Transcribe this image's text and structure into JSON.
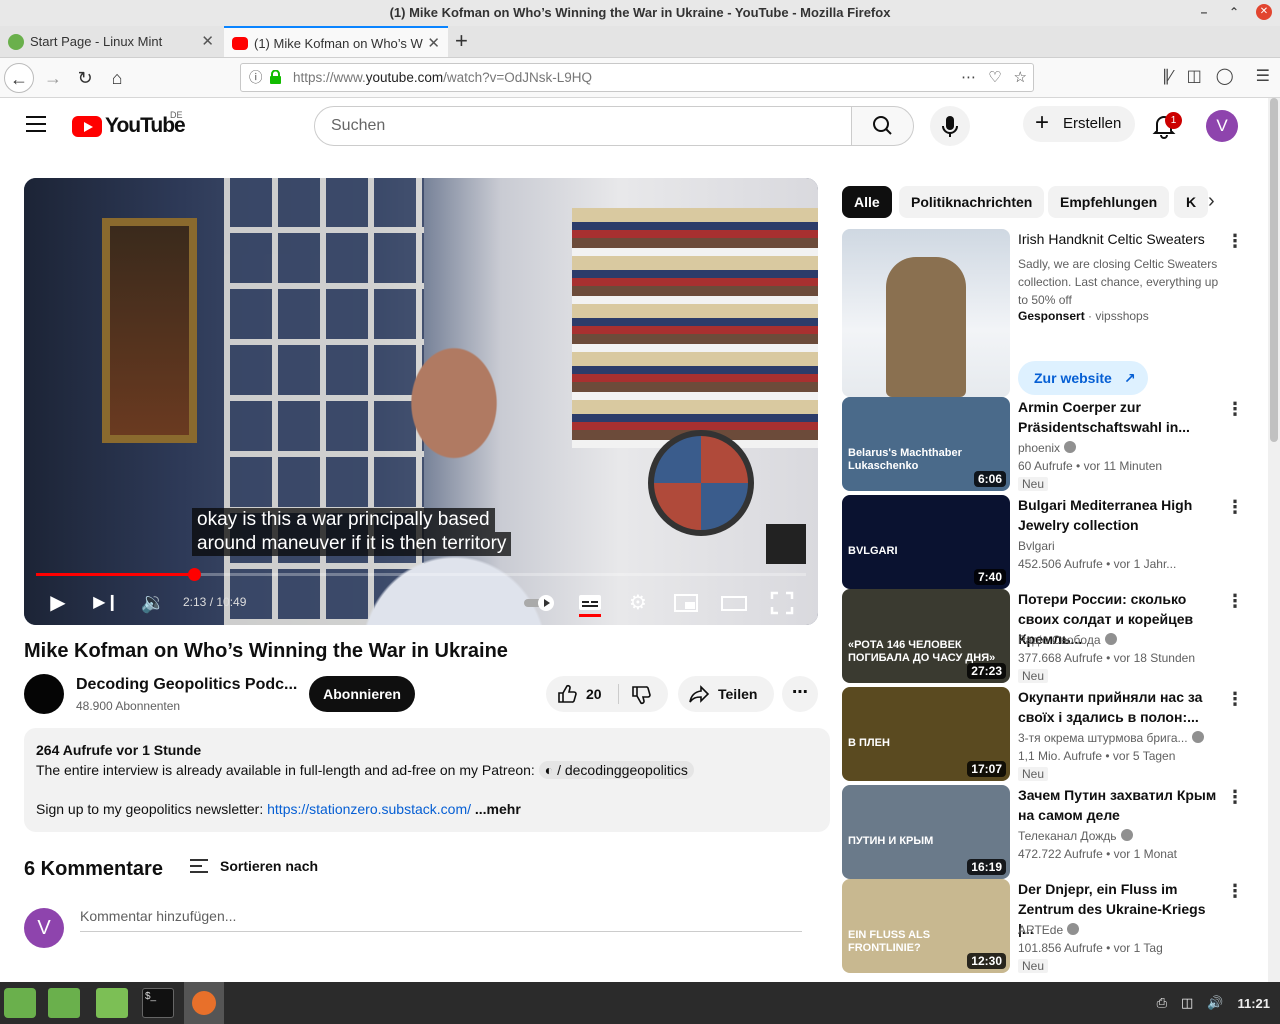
{
  "window": {
    "title": "(1) Mike Kofman on Who’s Winning the War in Ukraine - YouTube - Mozilla Firefox"
  },
  "tabs": [
    {
      "label": "Start Page - Linux Mint",
      "favicon_color": "#6ab04c"
    },
    {
      "label": "(1) Mike Kofman on Who’s W",
      "favicon_color": "#ff0000"
    }
  ],
  "address": {
    "prefix": "https://www.",
    "domain": "youtube.com",
    "path": "/watch?v=OdJNsk-L9HQ"
  },
  "yt": {
    "logo_text": "YouTube",
    "country": "DE",
    "search_placeholder": "Suchen",
    "create_label": "Erstellen",
    "notifications": "1",
    "avatar_letter": "V"
  },
  "player": {
    "caption_line1": "okay is this a war principally based",
    "caption_line2": "around maneuver if it is then territory",
    "time": "2:13 / 10:49",
    "progress": 0.205
  },
  "video": {
    "title": "Mike Kofman on Who’s Winning the War in Ukraine",
    "channel": "Decoding Geopolitics Podc...",
    "subscribers": "48.900 Abonnenten",
    "subscribe_label": "Abonnieren",
    "likes": "20",
    "share_label": "Teilen",
    "views_time": "264 Aufrufe  vor 1 Stunde",
    "desc_line1": "The entire interview is already available in full-length and ad-free on my Patreon:",
    "desc_chip": "/ decodinggeopolitics",
    "desc_line2": "Sign up to my geopolitics newsletter:",
    "desc_link": "https://stationzero.substack.com/",
    "more": "...mehr"
  },
  "comments": {
    "heading": "6 Kommentare",
    "sort_label": "Sortieren nach",
    "placeholder": "Kommentar hinzufügen..."
  },
  "chips": [
    "Alle",
    "Politiknachrichten",
    "Empfehlungen",
    "K"
  ],
  "ad": {
    "title": "Irish Handknit Celtic Sweaters",
    "desc": "Sadly, we are closing Celtic Sweaters collection. Last chance, everything up to 50% off",
    "sponsored": "Gesponsert",
    "advertiser": "vipsshops",
    "cta": "Zur website"
  },
  "recommendations": [
    {
      "title": "Armin Coerper zur Präsidentschaftswahl in...",
      "channel": "phoenix",
      "verified": true,
      "meta": "60 Aufrufe  •  vor 11 Minuten",
      "badge": "Neu",
      "duration": "6:06",
      "thumb_text": "Belarus's Machthaber Lukaschenko",
      "color": "#4a6a8a"
    },
    {
      "title": "Bulgari Mediterranea High Jewelry collection",
      "channel": "Bvlgari",
      "verified": false,
      "meta": "452.506 Aufrufe  •  vor 1 Jahr...",
      "badge": "",
      "duration": "7:40",
      "thumb_text": "BVLGARI",
      "color": "#0a1230"
    },
    {
      "title": "Потери России: сколько своих солдат и корейцев Кремль...",
      "channel": "Радіо Свобода",
      "verified": true,
      "meta": "377.668 Aufrufe  •  vor 18 Stunden",
      "badge": "Neu",
      "duration": "27:23",
      "thumb_text": "«РОТА 146 ЧЕЛОВЕК ПОГИБАЛА ДО ЧАСУ ДНЯ»",
      "color": "#3a3a30"
    },
    {
      "title": "Окупанти прийняли нас за своїх і здались в полон:...",
      "channel": "3-тя окрема штурмова брига...",
      "verified": true,
      "meta": "1,1 Mio. Aufrufe  •  vor 5 Tagen",
      "badge": "Neu",
      "duration": "17:07",
      "thumb_text": "В ПЛЕН",
      "color": "#5a4a20"
    },
    {
      "title": "Зачем Путин захватил Крым на самом деле",
      "channel": "Телеканал Дождь",
      "verified": true,
      "meta": "472.722 Aufrufe  •  vor 1 Monat",
      "badge": "",
      "duration": "16:19",
      "thumb_text": "ПУТИН И КРЫМ",
      "color": "#6a7a8a"
    },
    {
      "title": "Der Dnjepr, ein Fluss im Zentrum des Ukraine-Kriegs |...",
      "channel": "ARTEde",
      "verified": true,
      "meta": "101.856 Aufrufe  •  vor 1 Tag",
      "badge": "Neu",
      "duration": "12:30",
      "thumb_text": "EIN FLUSS ALS FRONTLINIE?",
      "color": "#c8b890"
    }
  ],
  "taskbar": {
    "clock": "11:21"
  }
}
